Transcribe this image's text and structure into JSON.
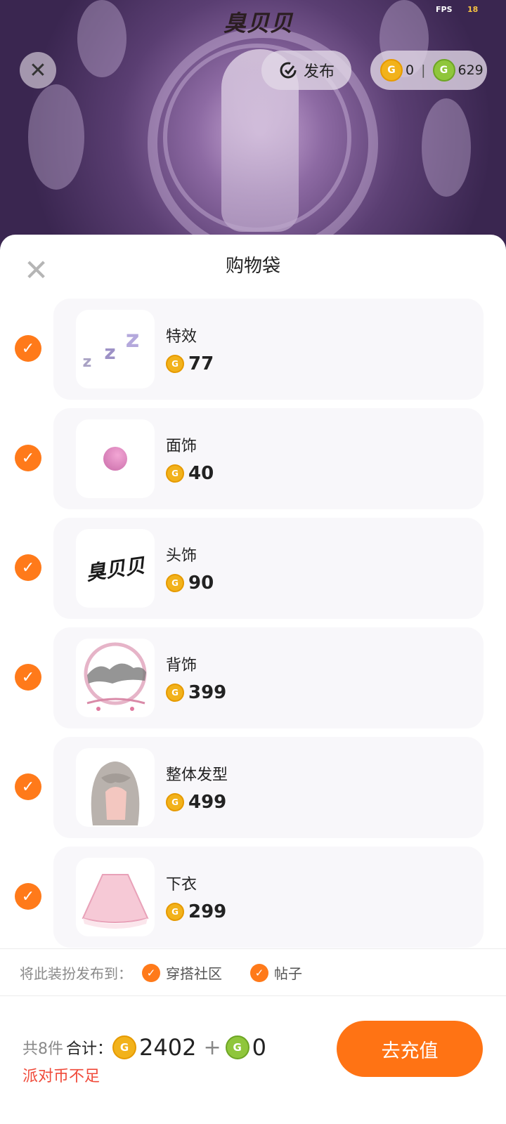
{
  "hud": {
    "fps_label": "FPS",
    "fps_value": "18"
  },
  "header": {
    "logo_text": "臭贝贝",
    "publish_label": "发布",
    "gold_balance": "0",
    "green_balance": "629"
  },
  "sheet": {
    "title": "购物袋",
    "items": [
      {
        "name": "特效",
        "price": "77",
        "thumb_icon": "zzz-effect-icon"
      },
      {
        "name": "面饰",
        "price": "40",
        "thumb_icon": "pink-dot-face-icon"
      },
      {
        "name": "头饰",
        "price": "90",
        "thumb_icon": "logo-text-head-icon"
      },
      {
        "name": "背饰",
        "price": "399",
        "thumb_icon": "ring-landscape-back-icon"
      },
      {
        "name": "整体发型",
        "price": "499",
        "thumb_icon": "long-hair-icon"
      },
      {
        "name": "下衣",
        "price": "299",
        "thumb_icon": "pink-skirt-icon"
      }
    ],
    "publish_to_label": "将此装扮发布到：",
    "publish_options": [
      "穿搭社区",
      "帖子"
    ]
  },
  "footer": {
    "count_label": "共8件",
    "total_label": "合计：",
    "gold_total": "2402",
    "plus": "+",
    "green_total": "0",
    "warning": "派对币不足",
    "cta_label": "去充值"
  },
  "colors": {
    "accent": "#ff7314",
    "warning": "#f04a3a",
    "gold": "#f2b21b",
    "green": "#8fc63b"
  }
}
